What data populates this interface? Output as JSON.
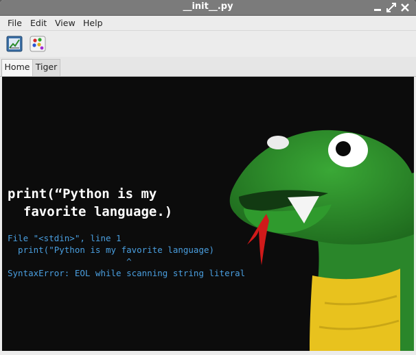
{
  "window": {
    "title": "__init__.py"
  },
  "menubar": {
    "items": [
      "File",
      "Edit",
      "View",
      "Help"
    ]
  },
  "toolbar": {
    "buttons": [
      {
        "icon": "chart-icon"
      },
      {
        "icon": "palette-icon"
      }
    ]
  },
  "tabs": {
    "items": [
      "Home",
      "Tiger"
    ],
    "active": "Home"
  },
  "image": {
    "headline": "print(“Python is my\n  favorite language.)",
    "traceback_line1": "File \"<stdin>\", line 1",
    "traceback_line2": "  print(\"Python is my favorite language)",
    "traceback_caret": "                       ^",
    "traceback_error": "SyntaxError: EOL while scanning string literal"
  },
  "colors": {
    "titlebar": "#7b7b7b",
    "error_text": "#4a9fe0",
    "snake_green": "#2e8f2c",
    "snake_yellow": "#e8c21e"
  }
}
